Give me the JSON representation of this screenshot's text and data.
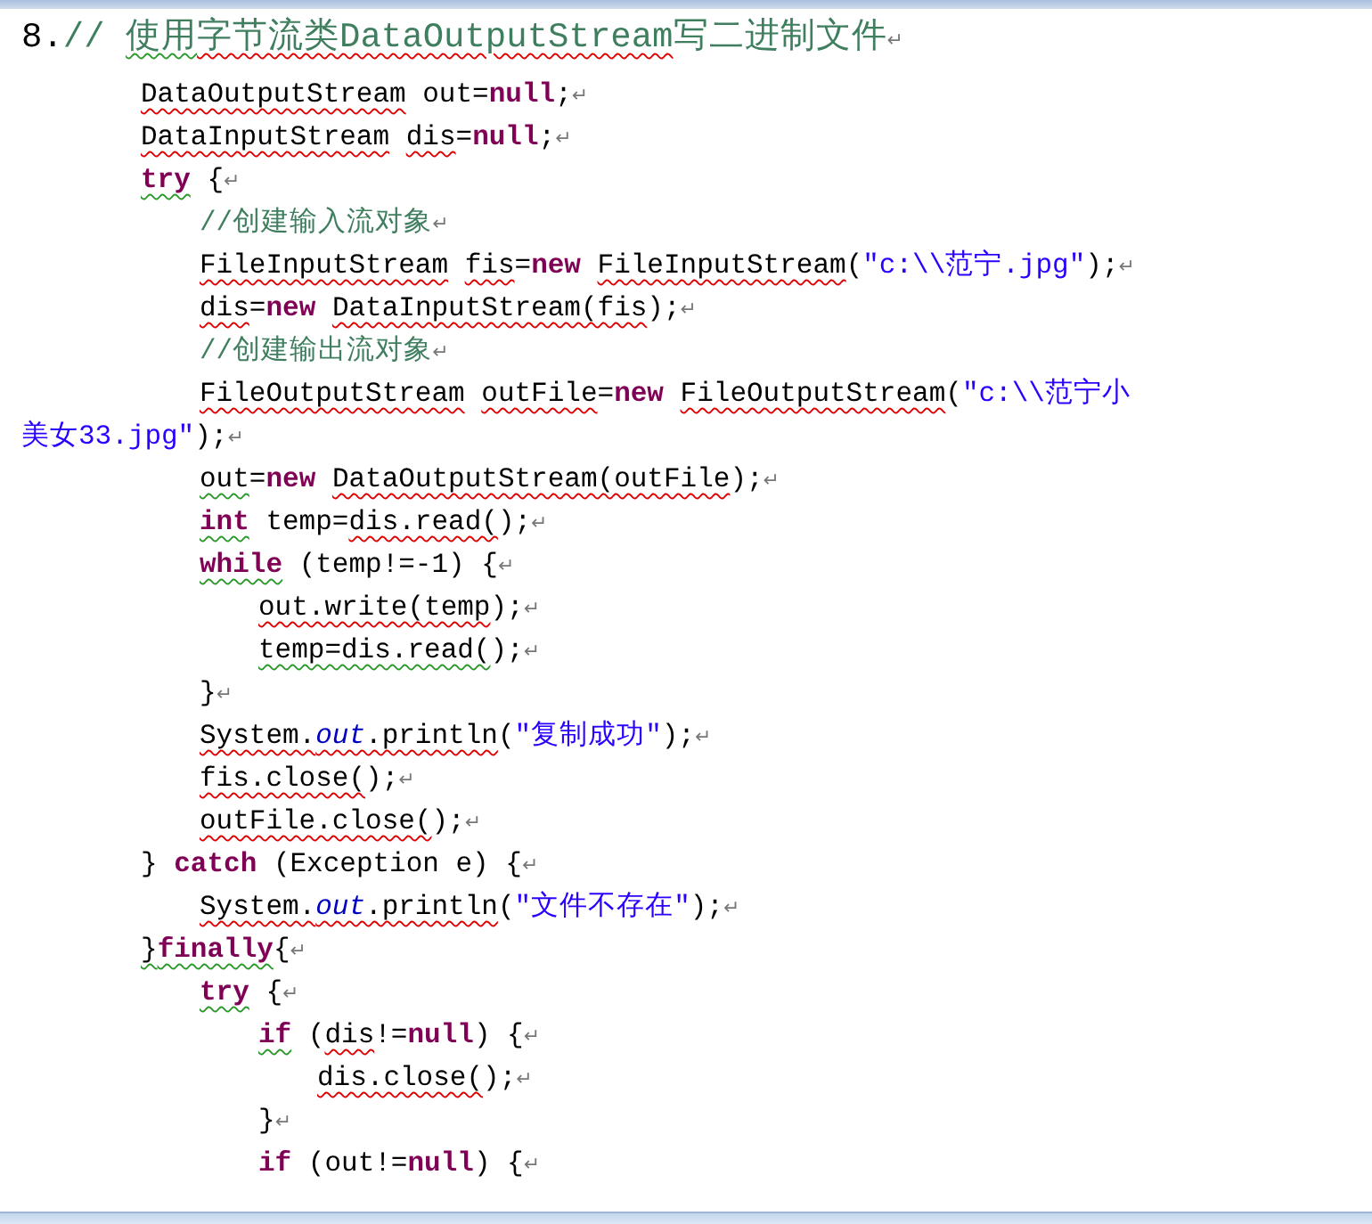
{
  "heading": {
    "number": "8.",
    "tokens": [
      {
        "text": "// ",
        "kind": "comment"
      },
      {
        "text": "使用",
        "kind": "comment",
        "grammar": true
      },
      {
        "text": "字节流类DataOutputStream",
        "kind": "comment",
        "spelling": true
      },
      {
        "text": "写二进制文件",
        "kind": "comment"
      }
    ],
    "mark": "↵"
  },
  "lines": [
    {
      "tokens": [
        {
          "text": "DataOutputStream",
          "kind": "plain",
          "spelling": true
        },
        {
          "text": " out=",
          "kind": "plain"
        },
        {
          "text": "null",
          "kind": "keyword"
        },
        {
          "text": ";",
          "kind": "plain"
        }
      ],
      "mark": "↵"
    },
    {
      "tokens": [
        {
          "text": "DataInputStream ",
          "kind": "plain",
          "spelling": true
        },
        {
          "text": "dis",
          "kind": "plain",
          "spelling": true
        },
        {
          "text": "=",
          "kind": "plain"
        },
        {
          "text": "null",
          "kind": "keyword"
        },
        {
          "text": ";",
          "kind": "plain"
        }
      ],
      "mark": "↵"
    },
    {
      "tokens": [
        {
          "text": "try",
          "kind": "keyword",
          "grammar": true
        },
        {
          "text": " {",
          "kind": "plain"
        }
      ],
      "mark": "↵",
      "children": [
        {
          "tokens": [
            {
              "text": "//创建输入流对象",
              "kind": "comment"
            }
          ],
          "mark": "↵"
        },
        {
          "tokens": [
            {
              "text": "FileInputStream ",
              "kind": "plain",
              "spelling": true
            },
            {
              "text": "fis",
              "kind": "plain",
              "spelling": true
            },
            {
              "text": "=",
              "kind": "plain"
            },
            {
              "text": "new ",
              "kind": "keyword"
            },
            {
              "text": "FileInputStream",
              "kind": "plain",
              "spelling": true
            },
            {
              "text": "(",
              "kind": "plain"
            },
            {
              "text": "\"c:\\\\范宁.jpg\"",
              "kind": "string"
            },
            {
              "text": ");",
              "kind": "plain"
            }
          ],
          "mark": "↵"
        },
        {
          "tokens": [
            {
              "text": "dis",
              "kind": "plain",
              "spelling": true
            },
            {
              "text": "=",
              "kind": "plain"
            },
            {
              "text": "new ",
              "kind": "keyword"
            },
            {
              "text": "DataInputStream(fis",
              "kind": "plain",
              "spelling": true
            },
            {
              "text": ");",
              "kind": "plain"
            }
          ],
          "mark": "↵"
        },
        {
          "tokens": [
            {
              "text": "//创建输出流对象",
              "kind": "comment"
            }
          ],
          "mark": "↵"
        },
        {
          "tokens": [
            {
              "text": "FileOutputStream ",
              "kind": "plain",
              "spelling": true
            },
            {
              "text": "outFile",
              "kind": "plain",
              "spelling": true
            },
            {
              "text": "=",
              "kind": "plain"
            },
            {
              "text": "new ",
              "kind": "keyword"
            },
            {
              "text": "FileOutputStream",
              "kind": "plain",
              "spelling": true
            },
            {
              "text": "(",
              "kind": "plain"
            },
            {
              "text": "\"c:\\\\范宁小",
              "kind": "string"
            }
          ],
          "wrap": [
            {
              "text": "美女33.jpg\"",
              "kind": "string"
            },
            {
              "text": ");",
              "kind": "plain"
            }
          ],
          "mark": "↵"
        },
        {
          "tokens": [
            {
              "text": "out",
              "kind": "plain",
              "grammar": true
            },
            {
              "text": "=",
              "kind": "plain"
            },
            {
              "text": "new ",
              "kind": "keyword"
            },
            {
              "text": "DataOutputStream(outFile",
              "kind": "plain",
              "spelling": true
            },
            {
              "text": ");",
              "kind": "plain"
            }
          ],
          "mark": "↵"
        },
        {
          "tokens": [
            {
              "text": "int",
              "kind": "keyword",
              "grammar": true
            },
            {
              "text": " temp=",
              "kind": "plain"
            },
            {
              "text": "dis.read(",
              "kind": "plain",
              "spelling": true
            },
            {
              "text": ");",
              "kind": "plain"
            }
          ],
          "mark": "↵"
        },
        {
          "tokens": [
            {
              "text": "while",
              "kind": "keyword",
              "grammar": true
            },
            {
              "text": " (temp!=-1) {",
              "kind": "plain"
            }
          ],
          "mark": "↵",
          "children": [
            {
              "tokens": [
                {
                  "text": "out.write(temp",
                  "kind": "plain",
                  "spelling": true
                },
                {
                  "text": ");",
                  "kind": "plain"
                }
              ],
              "mark": "↵"
            },
            {
              "tokens": [
                {
                  "text": "temp=dis.read(",
                  "kind": "plain",
                  "grammar": true
                },
                {
                  "text": ");",
                  "kind": "plain"
                }
              ],
              "mark": "↵"
            }
          ]
        },
        {
          "tokens": [
            {
              "text": "}",
              "kind": "plain"
            }
          ],
          "mark": "↵"
        },
        {
          "tokens": [
            {
              "text": "System.",
              "kind": "plain",
              "spelling": true
            },
            {
              "text": "out",
              "kind": "field",
              "spelling": true
            },
            {
              "text": ".println",
              "kind": "plain",
              "spelling": true
            },
            {
              "text": "(",
              "kind": "plain"
            },
            {
              "text": "\"复制成功\"",
              "kind": "string"
            },
            {
              "text": ");",
              "kind": "plain"
            }
          ],
          "mark": "↵"
        },
        {
          "tokens": [
            {
              "text": "fis.close(",
              "kind": "plain",
              "spelling": true
            },
            {
              "text": ");",
              "kind": "plain"
            }
          ],
          "mark": "↵"
        },
        {
          "tokens": [
            {
              "text": "outFile.close(",
              "kind": "plain",
              "spelling": true
            },
            {
              "text": ");",
              "kind": "plain"
            }
          ],
          "mark": "↵"
        }
      ]
    },
    {
      "tokens": [
        {
          "text": "} ",
          "kind": "plain"
        },
        {
          "text": "catch",
          "kind": "keyword"
        },
        {
          "text": " (Exception e) {",
          "kind": "plain"
        }
      ],
      "mark": "↵",
      "children": [
        {
          "tokens": [
            {
              "text": "System.",
              "kind": "plain",
              "spelling": true
            },
            {
              "text": "out",
              "kind": "field",
              "spelling": true
            },
            {
              "text": ".println",
              "kind": "plain",
              "spelling": true
            },
            {
              "text": "(",
              "kind": "plain"
            },
            {
              "text": "\"文件不存在\"",
              "kind": "string"
            },
            {
              "text": ");",
              "kind": "plain"
            }
          ],
          "mark": "↵"
        }
      ]
    },
    {
      "tokens": [
        {
          "text": "}",
          "kind": "plain",
          "grammar": true
        },
        {
          "text": "finally",
          "kind": "keyword",
          "grammar": true
        },
        {
          "text": "{",
          "kind": "plain"
        }
      ],
      "mark": "↵",
      "children": [
        {
          "tokens": [
            {
              "text": "try",
              "kind": "keyword",
              "grammar": true
            },
            {
              "text": " {",
              "kind": "plain"
            }
          ],
          "mark": "↵",
          "children": [
            {
              "tokens": [
                {
                  "text": "if",
                  "kind": "keyword",
                  "grammar": true
                },
                {
                  "text": " (",
                  "kind": "plain"
                },
                {
                  "text": "dis",
                  "kind": "plain",
                  "spelling": true
                },
                {
                  "text": "!=",
                  "kind": "plain"
                },
                {
                  "text": "null",
                  "kind": "keyword"
                },
                {
                  "text": ") {",
                  "kind": "plain"
                }
              ],
              "mark": "↵",
              "children": [
                {
                  "tokens": [
                    {
                      "text": "dis.close(",
                      "kind": "plain",
                      "spelling": true
                    },
                    {
                      "text": ");",
                      "kind": "plain"
                    }
                  ],
                  "mark": "↵"
                }
              ]
            },
            {
              "tokens": [
                {
                  "text": "}",
                  "kind": "plain"
                }
              ],
              "mark": "↵"
            },
            {
              "tokens": [
                {
                  "text": "if",
                  "kind": "keyword"
                },
                {
                  "text": " (out!=",
                  "kind": "plain"
                },
                {
                  "text": "null",
                  "kind": "keyword"
                },
                {
                  "text": ") {",
                  "kind": "plain"
                }
              ],
              "mark": "↵"
            }
          ]
        }
      ]
    }
  ]
}
